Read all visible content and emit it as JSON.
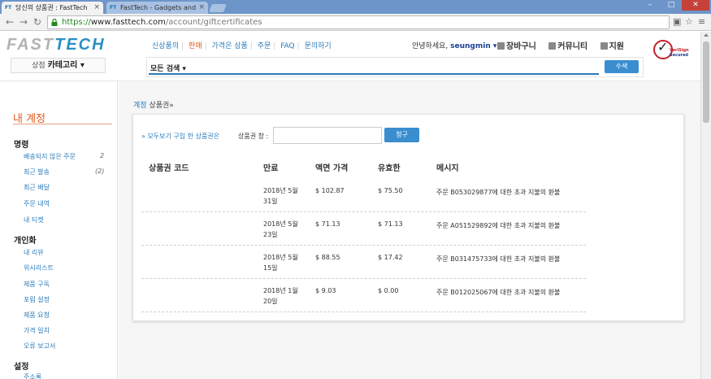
{
  "browser": {
    "tabs": [
      {
        "title": "당신의 상품권 : FastTech",
        "favicon": "FT",
        "active": true
      },
      {
        "title": "FastTech - Gadgets and",
        "favicon": "FT",
        "active": false
      }
    ],
    "url_scheme": "https://",
    "url_host": "www.fasttech.com",
    "url_path": "/account/giftcertificates",
    "window_controls": {
      "minimize": "–",
      "maximize": "□",
      "close": "✕"
    }
  },
  "header": {
    "logo_left": "FAST",
    "logo_right": "TECH",
    "category_prefix": "상점",
    "category_label": "카테고리 ▾",
    "nav": [
      "신상품의",
      "판매",
      "가격은 상품",
      "주문",
      "FAQ",
      "문의하기"
    ],
    "greeting": "안녕하세요,",
    "username": "seungmin ▾",
    "utility": [
      "장바구니",
      "커뮤니티",
      "지원"
    ],
    "search_scope": "모든 검색 ▾",
    "search_button": "수색",
    "seal_line1": "VeriSign",
    "seal_line2": "Secured"
  },
  "sidebar": {
    "title": "내 계정",
    "sections": [
      {
        "heading": "명령",
        "items": [
          {
            "label": "배송되지 않은 주문",
            "count": "2"
          },
          {
            "label": "최근 발송",
            "count": "(2)"
          },
          {
            "label": "최근 배달",
            "count": ""
          },
          {
            "label": "주문 내역",
            "count": ""
          },
          {
            "label": "내 티켓",
            "count": ""
          }
        ]
      },
      {
        "heading": "개인화",
        "items": [
          {
            "label": "내 리뷰"
          },
          {
            "label": "위시리스트"
          },
          {
            "label": "제품 구독"
          },
          {
            "label": "포럼 설정"
          },
          {
            "label": "제품 요청"
          },
          {
            "label": "가격 일치"
          },
          {
            "label": "오류 보고서"
          }
        ]
      },
      {
        "heading": "설정",
        "items": [
          {
            "label": "주소록"
          }
        ]
      }
    ]
  },
  "main": {
    "breadcrumb_link": "계정",
    "breadcrumb_current": "상품권»",
    "buy_link": "» 모두보기 구입 한 상품권은",
    "code_label": "상품권 창 :",
    "code_value": "",
    "claim_button": "청구",
    "columns": [
      "상품권 코드",
      "만료",
      "액면 가격",
      "유효한",
      "메시지"
    ],
    "rows": [
      {
        "code": "",
        "expiry_line1": "2018년 5월",
        "expiry_line2": "31일",
        "face": "$ 102.87",
        "valid": "$ 75.50",
        "message": "주문 B053029877에 대한 초과 지불의 환불"
      },
      {
        "code": "",
        "expiry_line1": "2018년 5월",
        "expiry_line2": "23일",
        "face": "$ 71.13",
        "valid": "$ 71.13",
        "message": "주문 A051529892에 대한 초과 지불의 환불"
      },
      {
        "code": "",
        "expiry_line1": "2018년 5월",
        "expiry_line2": "15일",
        "face": "$ 88.55",
        "valid": "$ 17.42",
        "message": "주문 B031475733에 대한 초과 지불의 환불"
      },
      {
        "code": "",
        "expiry_line1": "2018년 1월",
        "expiry_line2": "20일",
        "face": "$ 9.03",
        "valid": "$ 0.00",
        "message": "주문 B012025067에 대한 초과 지불의 환불"
      }
    ]
  }
}
